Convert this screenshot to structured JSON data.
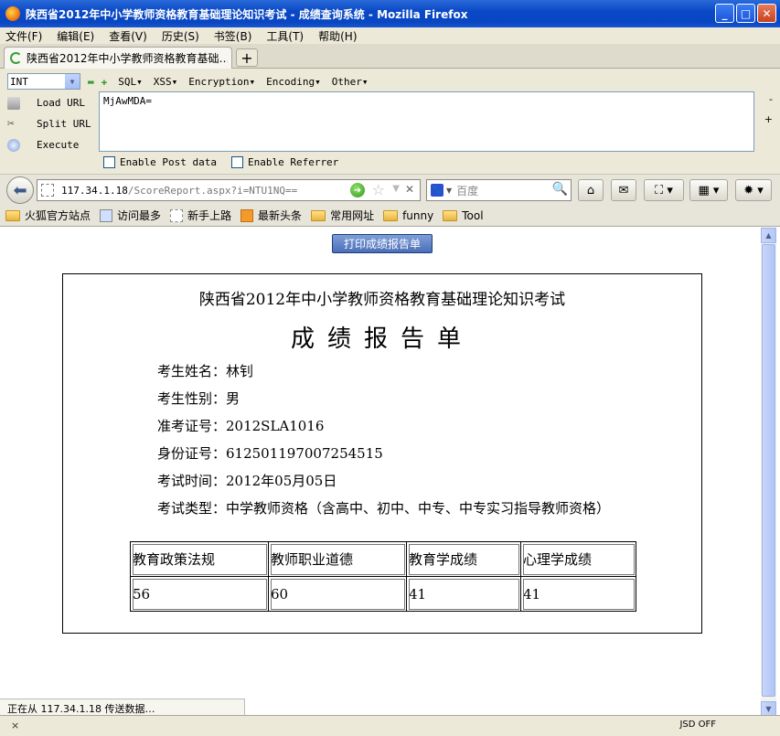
{
  "window": {
    "title": "陕西省2012年中小学教师资格教育基础理论知识考试 - 成绩查询系统 - Mozilla Firefox"
  },
  "menu": [
    "文件(F)",
    "编辑(E)",
    "查看(V)",
    "历史(S)",
    "书签(B)",
    "工具(T)",
    "帮助(H)"
  ],
  "tab": {
    "label": "陕西省2012年中小学教师资格教育基础…",
    "new_tab": "+"
  },
  "hackbar": {
    "type_select": "INT",
    "menus": [
      "SQL▾",
      "XSS▾",
      "Encryption▾",
      "Encoding▾",
      "Other▾"
    ],
    "actions": [
      "Load URL",
      "Split URL",
      "Execute"
    ],
    "text": "MjAwMDA=",
    "side_minus": "-",
    "side_plus": "+",
    "checks": [
      "Enable Post data",
      "Enable Referrer"
    ]
  },
  "nav": {
    "url_host": "117.34.1.18",
    "url_path": "/ScoreReport.aspx?i=NTU1NQ==",
    "search_placeholder": "百度"
  },
  "bookmarks": [
    "火狐官方站点",
    "访问最多",
    "新手上路",
    "最新头条",
    "常用网址",
    "funny",
    "Tool"
  ],
  "content": {
    "print_button": "打印成绩报告单",
    "report_title": "陕西省2012年中小学教师资格教育基础理论知识考试",
    "report_subtitle": "成绩报告单",
    "fields": [
      "考生姓名：林钊",
      "考生性别：男",
      "准考证号：2012SLA1016",
      "身份证号：612501197007254515",
      "考试时间：2012年05月05日",
      "考试类型：中学教师资格（含高中、初中、中专、中专实习指导教师资格）"
    ],
    "table": {
      "headers": [
        "教育政策法规",
        "教师职业道德",
        "教育学成绩",
        "心理学成绩"
      ],
      "values": [
        "56",
        "60",
        "41",
        "41"
      ]
    }
  },
  "status": {
    "text": "正在从 117.34.1.18 传送数据…",
    "close": "×",
    "addon_text": "JSD OFF"
  }
}
